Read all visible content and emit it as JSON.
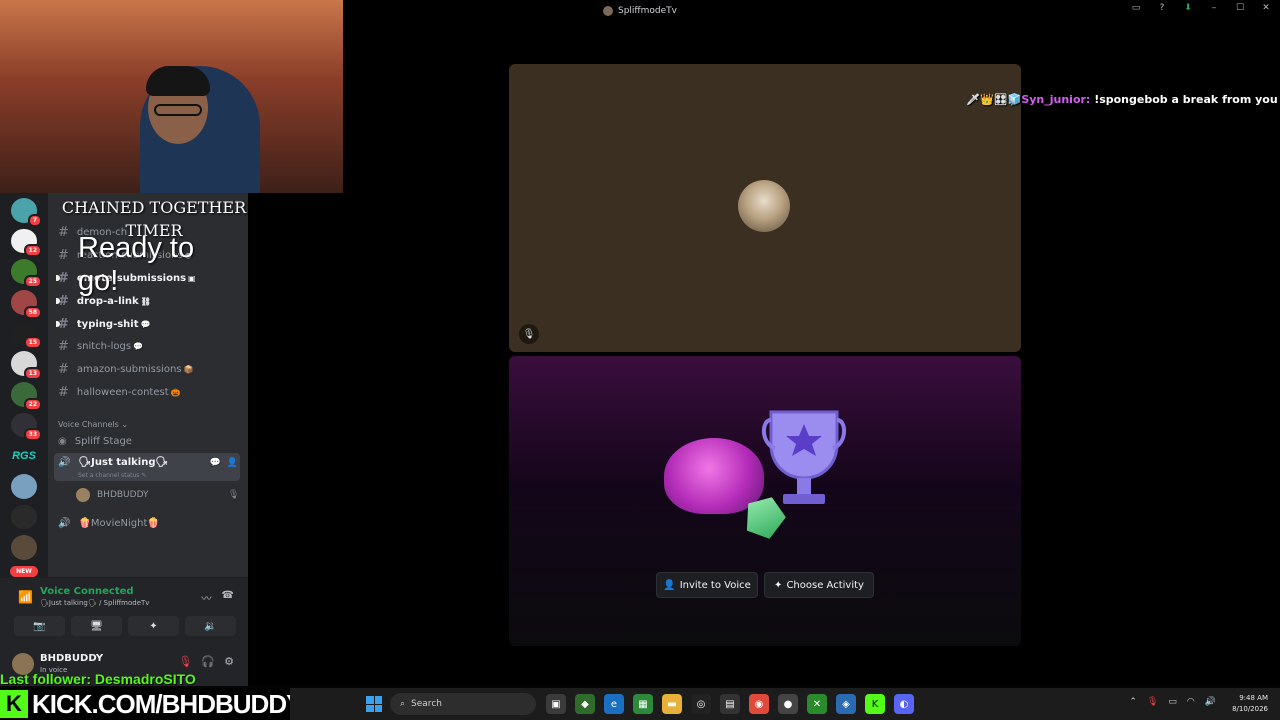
{
  "window": {
    "title": "SpliffmodeTv"
  },
  "servers": [
    {
      "badge": "7",
      "color": "#4aa3a8"
    },
    {
      "badge": "12",
      "color": "#f0f0f0"
    },
    {
      "badge": "25",
      "color": "#3c7a2c"
    },
    {
      "badge": "58",
      "color": "#a04646"
    },
    {
      "badge": "15",
      "color": "#202020"
    },
    {
      "badge": "13",
      "color": "#d8d8d8"
    },
    {
      "badge": "22",
      "color": "#3a6a3a"
    },
    {
      "badge": "33",
      "color": "#303036"
    },
    {
      "badge": "",
      "label": "RGS"
    },
    {
      "badge": "",
      "color": "#7aa0c0"
    },
    {
      "badge": "",
      "color": "#2a2a2a"
    },
    {
      "badge": "",
      "color": "#5a4a3a"
    }
  ],
  "rail_new": "NEW",
  "channels": [
    {
      "name": "demon-ch",
      "emoji": ""
    },
    {
      "name": "reaction-submissions",
      "emoji": "●"
    },
    {
      "name": "emote-submissions",
      "emoji": "▣"
    },
    {
      "name": "drop-a-link",
      "emoji": "⛓"
    },
    {
      "name": "typing-shit",
      "emoji": "💬"
    },
    {
      "name": "snitch-logs",
      "emoji": "💬"
    },
    {
      "name": "amazon-submissions",
      "emoji": "📦"
    },
    {
      "name": "halloween-contest",
      "emoji": "🎃"
    }
  ],
  "voice_header": "Voice Channels",
  "voice_channels": {
    "stage": "Spliff Stage",
    "active": "🗣Just talking🗣",
    "active_status": "Set a channel status",
    "user": "BHDBUDDY",
    "movie": "🍿MovieNight🍿"
  },
  "voice_panel": {
    "title": "Voice Connected",
    "subtitle": "🗣Just talking🗣 / SpliffmodeTv"
  },
  "user_panel": {
    "name": "BHDBUDDY",
    "status": "In voice"
  },
  "activity": {
    "invite": "Invite to Voice",
    "choose": "Choose Activity"
  },
  "overlay": {
    "title": "CHAINED TOGETHER TIMER",
    "ready": "Ready to go!",
    "chat_user": "Syn_junior:",
    "chat_msg": "!spongebob a break from you",
    "chat_icons": "🗡👑🎛🧊",
    "follower": "Last follower: DesmadroSITO",
    "kick_url": "KICK.COM/BHDBUDDY",
    "kick_logo": "K"
  },
  "taskbar": {
    "search": "Search",
    "time": "9:48 AM",
    "date": "8/10/2026"
  },
  "colors": {
    "accent_green": "#23a55a",
    "kick_green": "#53fc18",
    "badge_red": "#f23f43",
    "tile_brown": "#3a2f20"
  }
}
